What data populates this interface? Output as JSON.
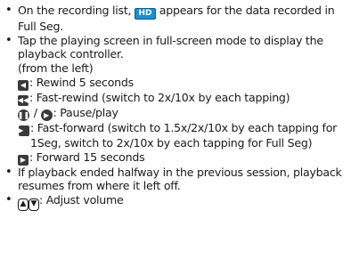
{
  "items": {
    "hd_before": "On the recording list, ",
    "hd_badge": "HD",
    "hd_after": " appears for the data recorded in Full Seg.",
    "tap_text": "Tap the playing screen in full-screen mode to display the playback controller.",
    "from_left": "(from the left)",
    "rewind5": ": Rewind 5 seconds",
    "fast_rewind": ": Fast-rewind (switch to 2x/10x by each tapping)",
    "pause_sep": "/",
    "pause_play": ": Pause/play",
    "fast_forward": ": Fast-forward (switch to 1.5x/2x/10x by each tapping for 1Seg, switch to 2x/10x by each tapping for Full Seg)",
    "forward15": ": Forward 15 seconds",
    "resume_text": "If playback ended halfway in the previous session, playback resumes from where it left off.",
    "volume_text": ": Adjust volume"
  },
  "icons": {
    "hd_color": "#1b8ed0",
    "rewind5": "rewind-5-icon",
    "fast_rewind": "fast-rewind-icon",
    "pause": "pause-icon",
    "play": "play-icon",
    "fast_forward": "fast-forward-icon",
    "forward15": "forward-15-icon",
    "volume_up": "volume-up-key-icon",
    "volume_down": "volume-down-key-icon"
  }
}
